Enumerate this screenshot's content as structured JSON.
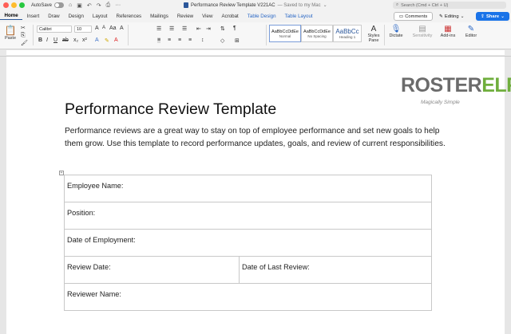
{
  "titlebar": {
    "autosave_label": "AutoSave",
    "document_title": "Performance Review Template V221AC",
    "save_status": "— Saved to my Mac",
    "search_placeholder": "Search (Cmd + Ctrl + U)"
  },
  "menu_tabs": [
    {
      "label": "Home",
      "active": true
    },
    {
      "label": "Insert"
    },
    {
      "label": "Draw"
    },
    {
      "label": "Design"
    },
    {
      "label": "Layout"
    },
    {
      "label": "References"
    },
    {
      "label": "Mailings"
    },
    {
      "label": "Review"
    },
    {
      "label": "View"
    },
    {
      "label": "Acrobat"
    },
    {
      "label": "Table Design",
      "contextual": true
    },
    {
      "label": "Table Layout",
      "contextual": true
    }
  ],
  "actions": {
    "comments_label": "Comments",
    "editing_label": "Editing",
    "share_label": "Share"
  },
  "ribbon": {
    "paste_label": "Paste",
    "font_name": "Calibri",
    "font_size": "10",
    "styles": [
      {
        "preview": "AaBbCcDdEe",
        "name": "Normal"
      },
      {
        "preview": "AaBbCcDdEe",
        "name": "No Spacing"
      },
      {
        "preview": "AaBbCc",
        "name": "Heading 1"
      }
    ],
    "styles_pane_label": "Styles\nPane",
    "dictate_label": "Dictate",
    "sensitivity_label": "Sensitivity",
    "addins_label": "Add-ins",
    "editor_label": "Editor"
  },
  "logo": {
    "brand": "ROSTERELF",
    "tagline": "Magically Simple"
  },
  "document": {
    "title": "Performance Review Template",
    "intro": "Performance reviews are a great way to stay on top of employee performance and set new goals to help them grow. Use this template to record performance updates, goals, and review of current responsibilities.",
    "table_rows": [
      [
        "Employee Name:"
      ],
      [
        "Position:"
      ],
      [
        "Date of Employment:"
      ],
      [
        "Review Date:",
        "Date of Last Review:"
      ],
      [
        "Reviewer Name:"
      ]
    ]
  },
  "colors": {
    "accent": "#2b579a",
    "share": "#1a73e8",
    "logo_green": "#6fae3c"
  }
}
